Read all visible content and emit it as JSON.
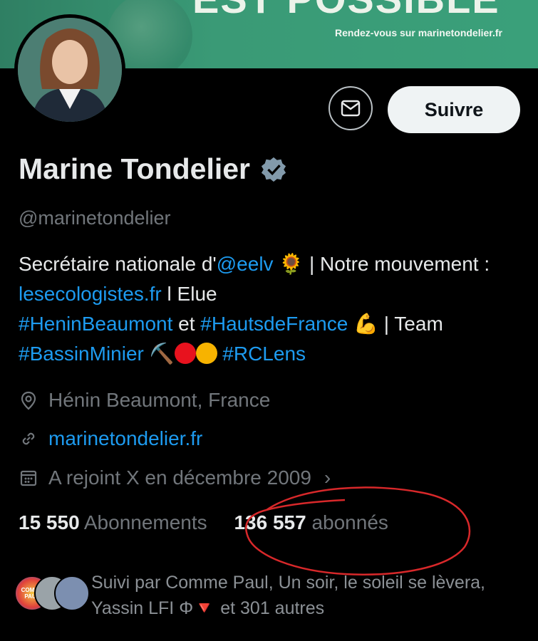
{
  "banner": {
    "headline": "EST POSSIBLE",
    "subtext": "Rendez-vous sur marinetondelier.fr"
  },
  "profile": {
    "name": "Marine Tondelier",
    "handle": "@marinetondelier",
    "follow_label": "Suivre"
  },
  "bio": {
    "part1": "Secrétaire nationale d'",
    "mention": "@eelv",
    "emoji1": "🌻",
    "part2": " | Notre mouvement : ",
    "link": "lesecologistes.fr",
    "part3": " l Elue ",
    "tag1": "#HeninBeaumont",
    "part4": " et ",
    "tag2": "#HautsdeFrance",
    "emoji2": "💪",
    "part5": " | Team ",
    "tag3": "#BassinMinier",
    "emoji3": "⛏️",
    "tag4": "#RCLens"
  },
  "meta": {
    "location": "Hénin Beaumont, France",
    "website": "marinetondelier.fr",
    "joined": "A rejoint X en décembre 2009",
    "joined_chevron": "›"
  },
  "stats": {
    "following_count": "15 550",
    "following_label": "Abonnements",
    "followers_count": "136 557",
    "followers_label": "abonnés"
  },
  "followed_by": {
    "text": "Suivi par Comme Paul, Un soir, le soleil se lèvera, Yassin LFI Φ🔻 et 301 autres",
    "avatar1_label": "COMME PAUL"
  },
  "colors": {
    "link": "#1d9bf0",
    "annotation": "#d8282a",
    "banner": "#3a9a76"
  }
}
